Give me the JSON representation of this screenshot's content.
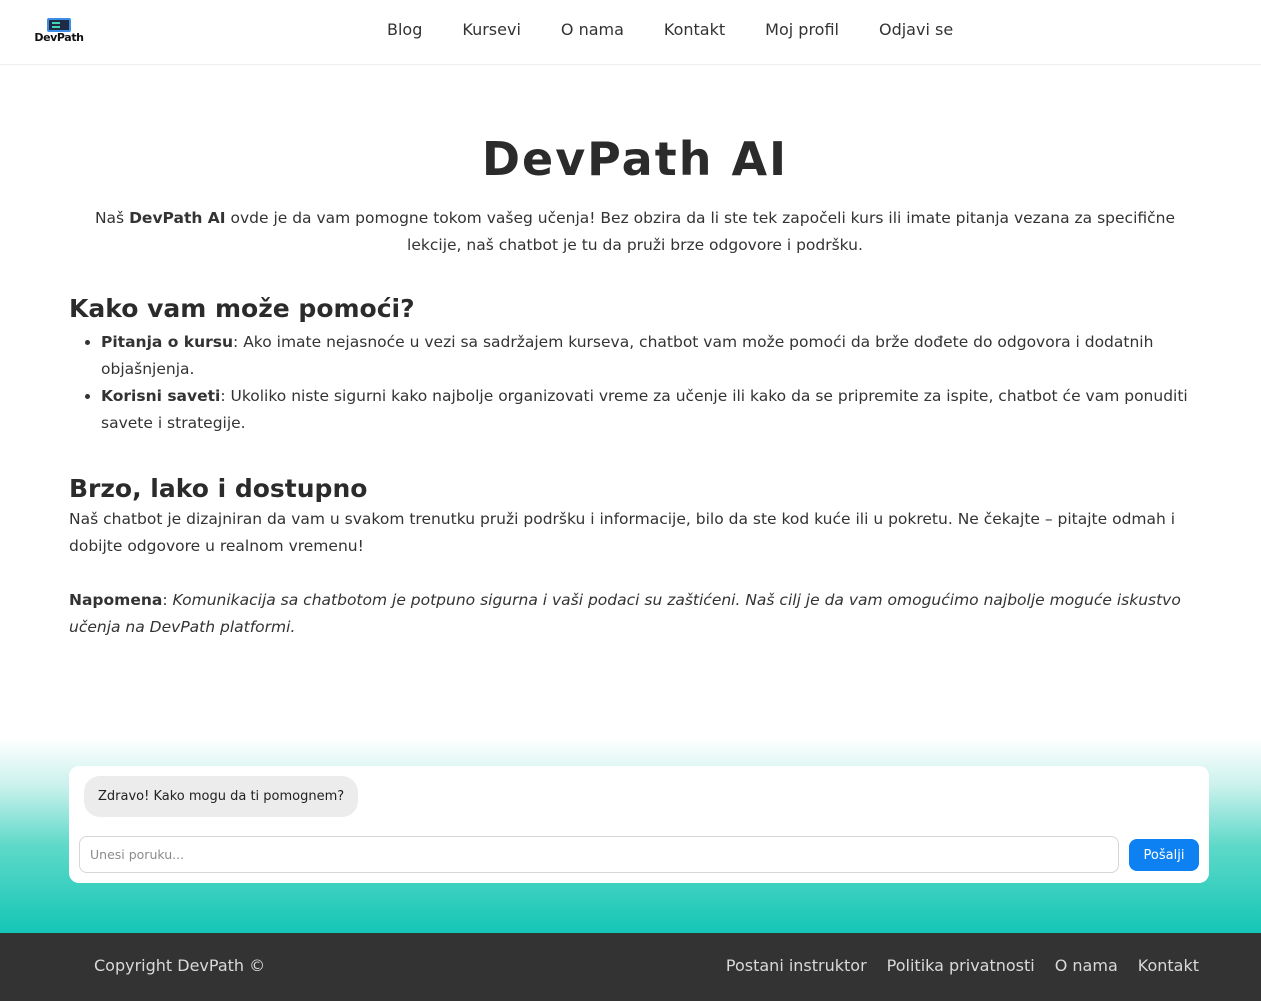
{
  "brand": {
    "logo_text": "DevPath"
  },
  "nav": {
    "items": [
      "Blog",
      "Kursevi",
      "O nama",
      "Kontakt",
      "Moj profil",
      "Odjavi se"
    ]
  },
  "hero": {
    "title": "DevPath AI",
    "intro_before": "Naš ",
    "intro_strong": "DevPath AI",
    "intro_after": " ovde je da vam pomogne tokom vašeg učenja! Bez obzira da li ste tek započeli kurs ili imate pitanja vezana za specifične lekcije, naš chatbot je tu da pruži brze odgovore i podršku."
  },
  "help": {
    "heading": "Kako vam može pomoći?",
    "items": [
      {
        "strong": "Pitanja o kursu",
        "text": ": Ako imate nejasnoće u vezi sa sadržajem kurseva, chatbot vam može pomoći da brže dođete do odgovora i dodatnih objašnjenja."
      },
      {
        "strong": "Korisni saveti",
        "text": ": Ukoliko niste sigurni kako najbolje organizovati vreme za učenje ili kako da se pripremite za ispite, chatbot će vam ponuditi savete i strategije."
      }
    ]
  },
  "fast": {
    "heading": "Brzo, lako i dostupno",
    "text": "Naš chatbot je dizajniran da vam u svakom trenutku pruži podršku i informacije, bilo da ste kod kuće ili u pokretu. Ne čekajte – pitajte odmah i dobijte odgovore u realnom vremenu!"
  },
  "note": {
    "label": "Napomena",
    "separator": ": ",
    "text": "Komunikacija sa chatbotom je potpuno sigurna i vaši podaci su zaštićeni. Naš cilj je da vam omogućimo najbolje moguće iskustvo učenja na DevPath platformi."
  },
  "chat": {
    "greeting": "Zdravo! Kako mogu da ti pomognem?",
    "input_value": "",
    "input_placeholder": "Unesi poruku...",
    "send_label": "Pošalji"
  },
  "footer": {
    "copyright": "Copyright DevPath ©",
    "links": [
      "Postani instruktor",
      "Politika privatnosti",
      "O nama",
      "Kontakt"
    ]
  },
  "colors": {
    "accent_button": "#0d80f2",
    "gradient_teal": "#14c6b6",
    "footer_bg": "#333333",
    "bubble_bg": "#ececec"
  }
}
